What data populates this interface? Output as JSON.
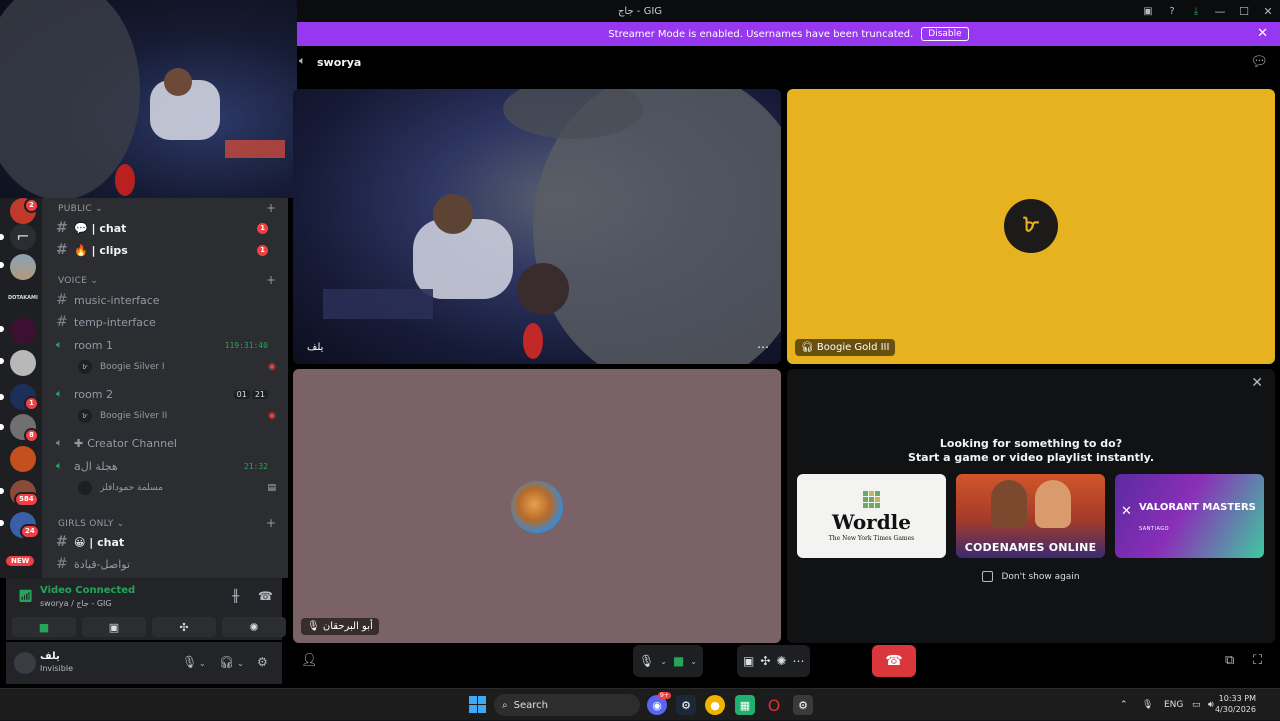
{
  "window": {
    "title": "جاج - GIG",
    "icons": [
      "screen-icon",
      "help-icon",
      "download-icon"
    ],
    "minimize": "—",
    "maximize": "☐",
    "close": "✕"
  },
  "banner": {
    "text": "Streamer Mode is enabled. Usernames have been truncated.",
    "disable_label": "Disable"
  },
  "servers": {
    "badges": [
      "2",
      "1",
      "8",
      "584",
      "24"
    ],
    "label_dotakami": "DOTAKAMI",
    "new_label": "NEW"
  },
  "channels": {
    "categories": {
      "public": "PUBLIC",
      "voice": "VOICE",
      "girls_only": "GIRLS ONLY"
    },
    "public_items": [
      {
        "label": "💬 | chat",
        "count": "1"
      },
      {
        "label": "🔥 | clips",
        "count": "1"
      }
    ],
    "voice_text": [
      {
        "label": "music-interface"
      },
      {
        "label": "temp-interface"
      }
    ],
    "room1": {
      "label": "room 1",
      "timer": "119:31:40",
      "user": "Boogie Silver I"
    },
    "room2": {
      "label": "room 2",
      "count_a": "01",
      "count_b": "21",
      "user": "Boogie Silver II"
    },
    "creator": {
      "label": "Creator Channel"
    },
    "arabic_room": {
      "label": "aهجلة ال",
      "timer": "21:32",
      "user": "مسلمة حمودافلز"
    },
    "girls_items": [
      {
        "label": "😀 | chat"
      },
      {
        "label": "تواصل-قيادة"
      }
    ]
  },
  "voice_status": {
    "title": "Video Connected",
    "subtitle": "sworya / جاج - GIG"
  },
  "user": {
    "name": "يلف",
    "status": "Invisible"
  },
  "stage": {
    "channel_name": "sworya",
    "tiles": {
      "cam_name": "يلف",
      "gold_name": "Boogie Gold III",
      "mauve_name": "أبو البرحقان"
    },
    "promo": {
      "line1": "Looking for something to do?",
      "line2": "Start a game or video playlist instantly.",
      "wordle_title": "Wordle",
      "wordle_sub": "The New York Times Games",
      "codenames_title": "CODENAMES ONLINE",
      "valorant_title": "VALORANT MASTERS",
      "valorant_sub": "SANTIAGO",
      "dont_show": "Don't show again"
    }
  },
  "taskbar": {
    "search_placeholder": "Search",
    "discord_badge": "9+",
    "lang": "ENG",
    "time": "10:33 PM",
    "date": "4/30/2026"
  },
  "colors": {
    "accent_purple": "#9837f0",
    "connected_green": "#23a55a",
    "hangup_red": "#da373c",
    "gold_tile": "#e6b21f"
  }
}
